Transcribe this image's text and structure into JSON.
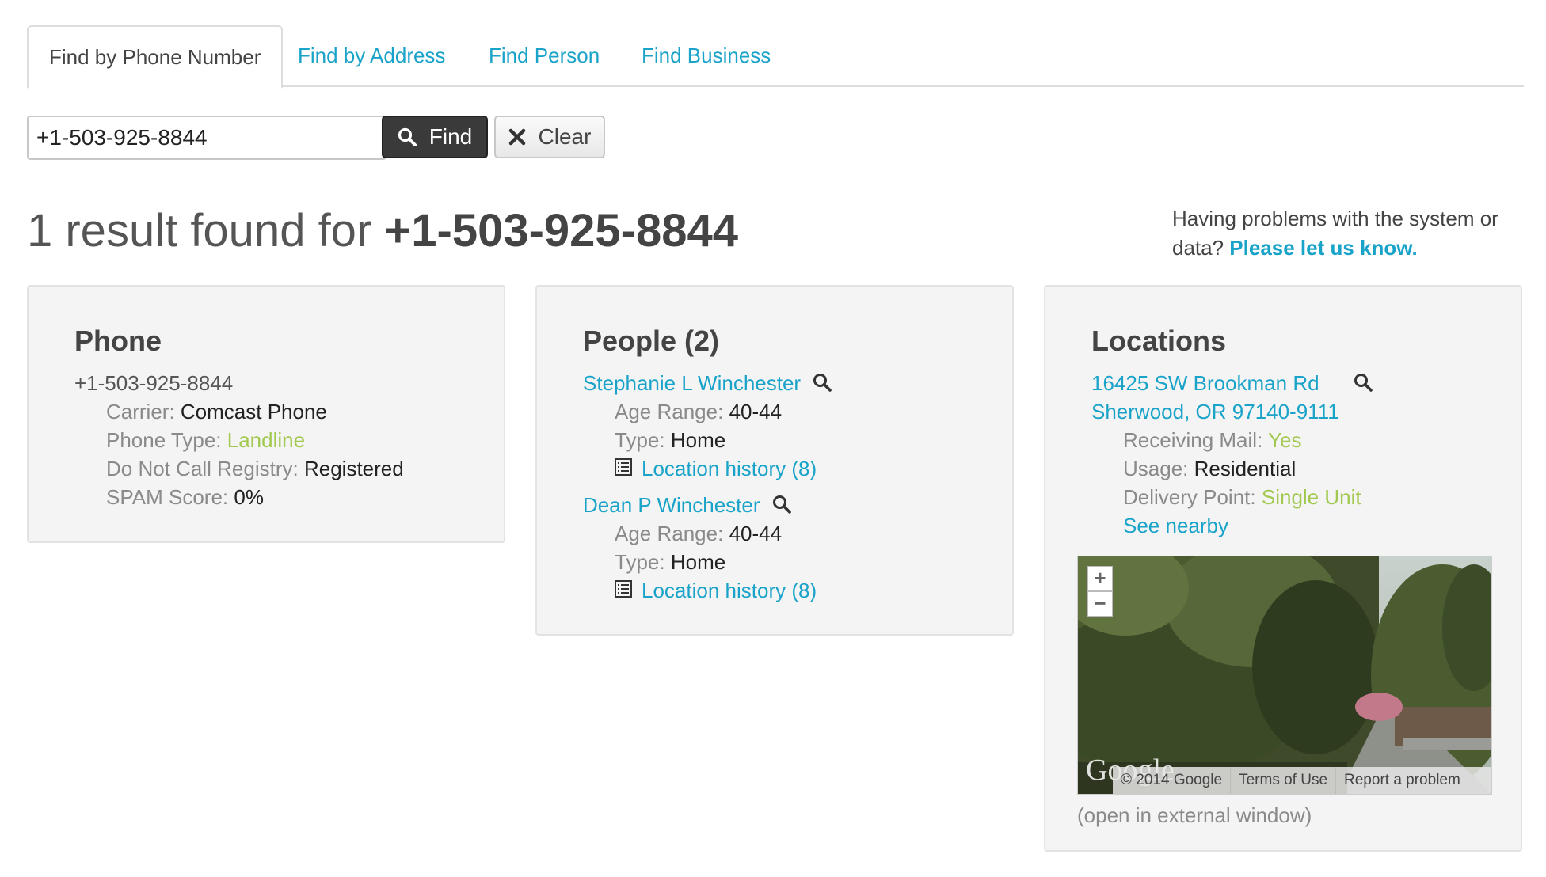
{
  "tabs": [
    {
      "label": "Find by Phone Number",
      "active": true
    },
    {
      "label": "Find by Address"
    },
    {
      "label": "Find Person"
    },
    {
      "label": "Find Business"
    }
  ],
  "search": {
    "value": "+1-503-925-8844",
    "find_label": "Find",
    "clear_label": "Clear"
  },
  "result": {
    "prefix": "1 result found for ",
    "number": "+1-503-925-8844"
  },
  "help": {
    "text": "Having problems with the system or data? ",
    "link": "Please let us know."
  },
  "phone_panel": {
    "title": "Phone",
    "number": "+1-503-925-8844",
    "carrier_label": "Carrier:",
    "carrier": "Comcast Phone",
    "type_label": "Phone Type:",
    "type": "Landline",
    "dnc_label": "Do Not Call Registry:",
    "dnc": "Registered",
    "spam_label": "SPAM Score:",
    "spam": "0%"
  },
  "people_panel": {
    "title": "People (2)",
    "people": [
      {
        "name": "Stephanie L Winchester",
        "age_label": "Age Range:",
        "age": "40-44",
        "type_label": "Type:",
        "type": "Home",
        "history": "Location history (8)"
      },
      {
        "name": "Dean P Winchester",
        "age_label": "Age Range:",
        "age": "40-44",
        "type_label": "Type:",
        "type": "Home",
        "history": "Location history (8)"
      }
    ]
  },
  "locations_panel": {
    "title": "Locations",
    "address1": "16425 SW Brookman Rd",
    "address2": "Sherwood, OR 97140-9111",
    "mail_label": "Receiving Mail:",
    "mail": "Yes",
    "usage_label": "Usage:",
    "usage": "Residential",
    "delivery_label": "Delivery Point:",
    "delivery": "Single Unit",
    "nearby": "See nearby",
    "map": {
      "zoom_in": "+",
      "zoom_out": "−",
      "logo": "Google",
      "copyright": "© 2014 Google",
      "terms": "Terms of Use",
      "report": "Report a problem"
    },
    "external": "(open in external window)"
  },
  "colors": {
    "link": "#1aa3c9",
    "green": "#a2c94f",
    "dark_button": "#3a3a3a"
  }
}
